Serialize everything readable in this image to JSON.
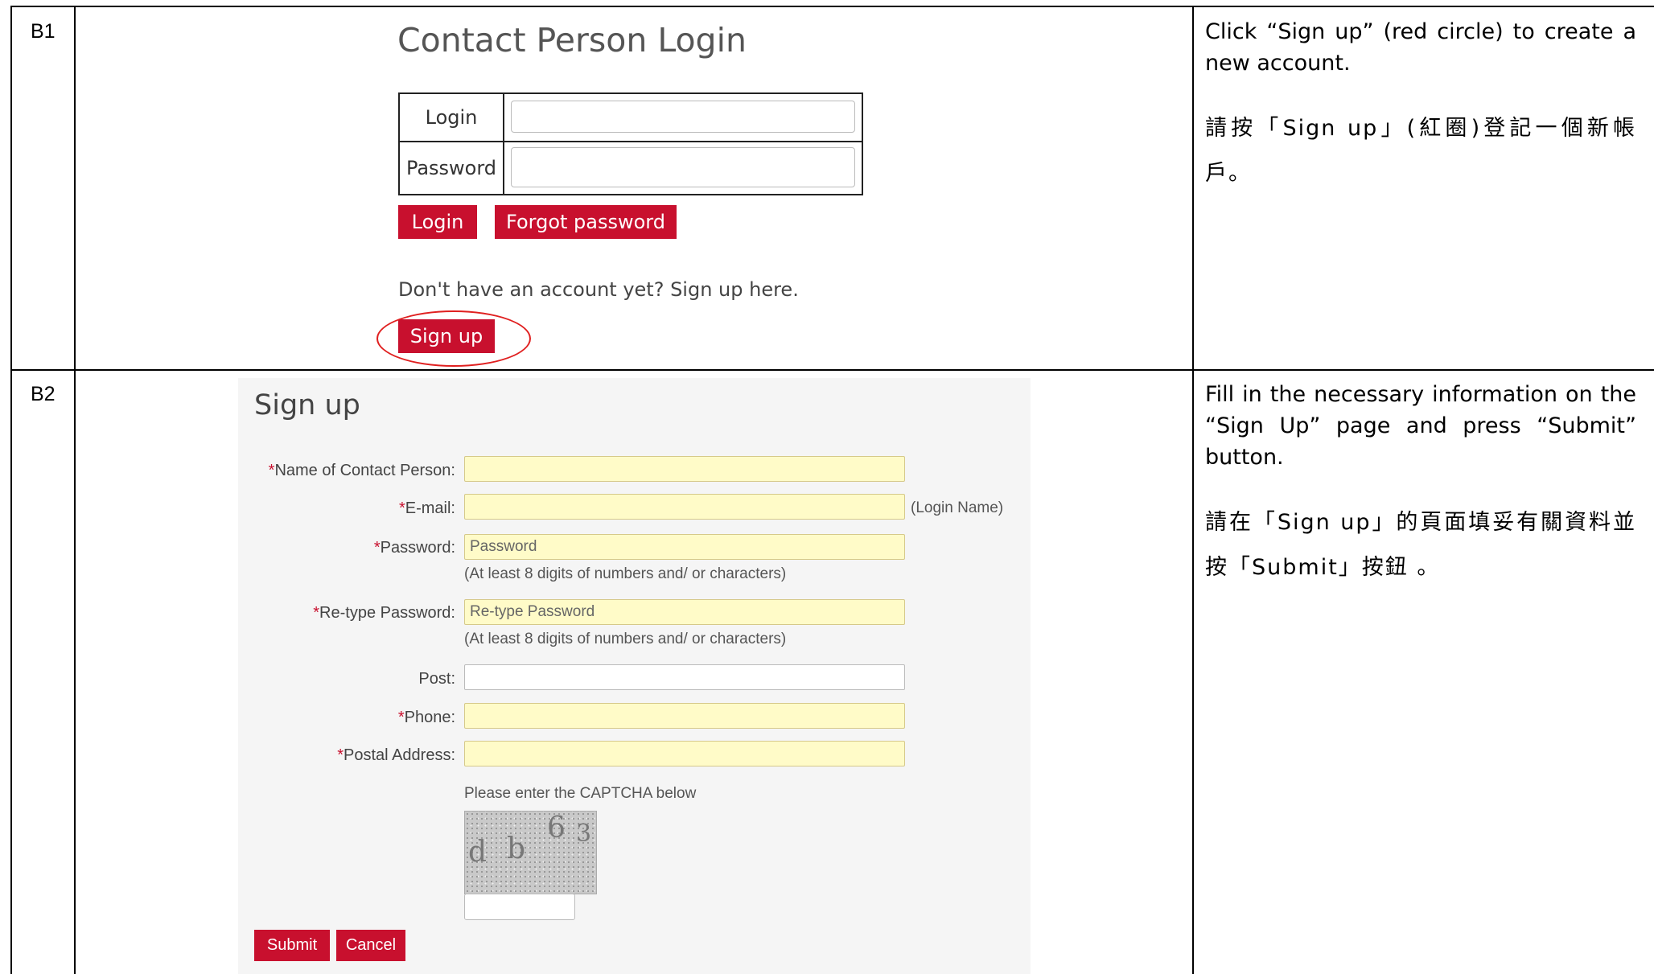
{
  "rows": [
    {
      "step": "B1",
      "description_en": "Click “Sign up” (red circle) to create a new account.",
      "description_zh": "請按「Sign up」(紅圈)登記一個新帳戶。",
      "screenshot": {
        "title": "Contact Person Login",
        "login_label": "Login",
        "password_label": "Password",
        "login_button": "Login",
        "forgot_button": "Forgot password",
        "signup_prompt": "Don't have an account yet? Sign up here.",
        "signup_button": "Sign up"
      }
    },
    {
      "step": "B2",
      "description_en": "Fill in the necessary information on the “Sign Up” page and press “Submit” button.",
      "description_zh": "請在「Sign up」的頁面填妥有關資料並按「Submit」按鈕 。",
      "screenshot": {
        "title": "Sign up",
        "required_mark": "*",
        "fields": {
          "name": "Name of Contact Person:",
          "email": "E-mail:",
          "email_note": "(Login Name)",
          "password": "Password:",
          "password_placeholder": "Password",
          "password_hint": "(At least 8 digits of numbers and/ or characters)",
          "retype": "Re-type Password:",
          "retype_placeholder": "Re-type Password",
          "retype_hint": "(At least 8 digits of numbers and/ or characters)",
          "post": "Post:",
          "phone": "Phone:",
          "address": "Postal Address:"
        },
        "captcha_prompt": "Please enter the CAPTCHA below",
        "captcha_chars": [
          "d",
          "b",
          "6",
          "3"
        ],
        "submit_button": "Submit",
        "cancel_button": "Cancel"
      }
    }
  ]
}
